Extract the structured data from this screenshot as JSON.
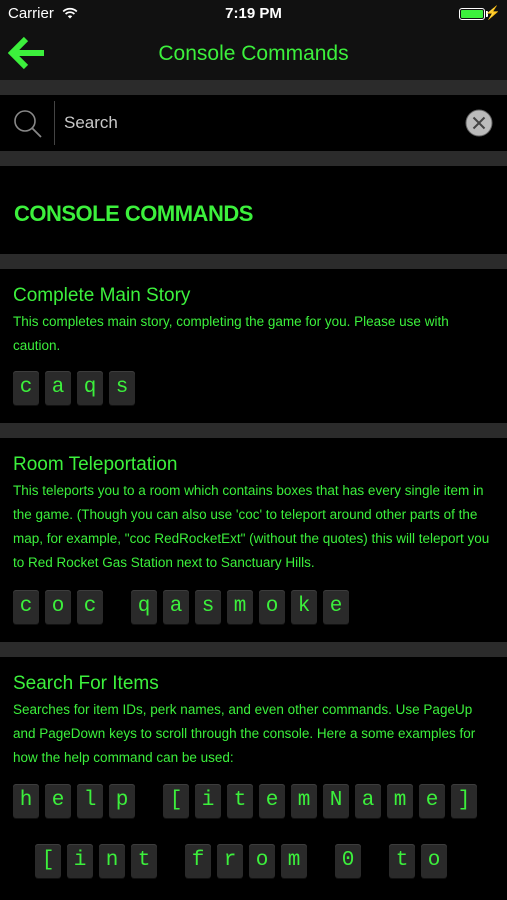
{
  "status": {
    "carrier": "Carrier",
    "time": "7:19 PM"
  },
  "nav": {
    "title": "Console Commands"
  },
  "search": {
    "placeholder": "Search"
  },
  "section_heading": "CONSOLE COMMANDS",
  "cards": [
    {
      "title": "Complete Main Story",
      "description": "This completes main story, completing the game for you. Please use with caution.",
      "command_rows": [
        [
          "c",
          "a",
          "q",
          "s"
        ]
      ]
    },
    {
      "title": "Room Teleportation",
      "description": "This teleports you to a room which contains boxes that has every single item in the game. (Though you can also use 'coc' to teleport around other parts of the map, for example, \"coc RedRocketExt\" (without the quotes) this will teleport you to Red Rocket Gas Station next to Sanctuary Hills.",
      "command_rows": [
        [
          "c",
          "o",
          "c",
          " ",
          "q",
          "a",
          "s",
          "m",
          "o",
          "k",
          "e"
        ]
      ]
    },
    {
      "title": "Search For Items",
      "description": "Searches for item IDs, perk names, and even other commands. Use PageUp and PageDown keys to scroll through the console. Here a some examples for how the help command can be used:",
      "command_rows": [
        [
          "h",
          "e",
          "l",
          "p",
          " ",
          "[",
          "i",
          "t",
          "e",
          "m",
          "N",
          "a",
          "m",
          "e",
          "]"
        ],
        [
          "[",
          "i",
          "n",
          "t",
          " ",
          "f",
          "r",
          "o",
          "m",
          " ",
          "0",
          " ",
          "t",
          "o"
        ]
      ]
    }
  ],
  "colors": {
    "accent": "#3cf03c",
    "background": "#000000",
    "separator": "#2b2b2b",
    "key_bg": "#2a2a2a"
  }
}
